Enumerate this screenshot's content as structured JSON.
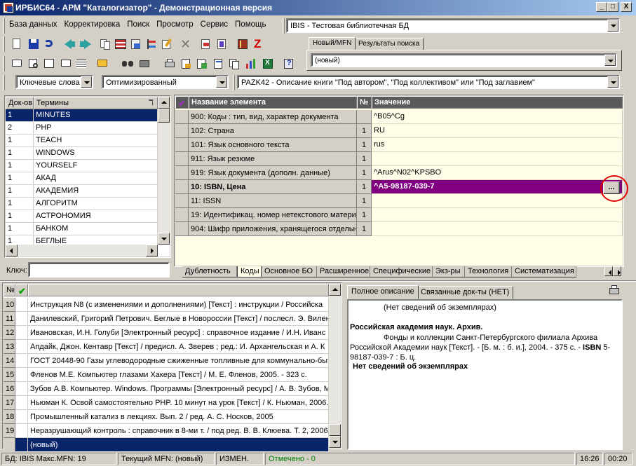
{
  "window": {
    "title": "ИРБИС64 - АРМ \"Каталогизатор\" - Демонстрационная версия",
    "controls": [
      "_",
      "□",
      "X"
    ]
  },
  "menu": [
    "База данных",
    "Корректировка",
    "Поиск",
    "Просмотр",
    "Сервис",
    "Помощь"
  ],
  "database_combo": "IBIS - Тестовая библиотечная БД",
  "top_tabs": [
    "Новый/MFN",
    "Результаты поиска"
  ],
  "mfn_combo": "(новый)",
  "search": {
    "mode": "Ключевые слова",
    "method": "Оптимизированный",
    "worksheet": "PAZK42 - Описание книги \"Под автором\", \"Под коллективом\" или \"Под заглавием\""
  },
  "terms": {
    "headers": [
      "Док-ов",
      "Термины"
    ],
    "rows": [
      {
        "count": "1",
        "term": "MINUTES"
      },
      {
        "count": "2",
        "term": "PHP"
      },
      {
        "count": "1",
        "term": "TEACH"
      },
      {
        "count": "1",
        "term": "WINDOWS"
      },
      {
        "count": "1",
        "term": "YOURSELF"
      },
      {
        "count": "1",
        "term": "АКАД"
      },
      {
        "count": "1",
        "term": "АКАДЕМИЯ"
      },
      {
        "count": "1",
        "term": "АЛГОРИТМ"
      },
      {
        "count": "1",
        "term": "АСТРОНОМИЯ"
      },
      {
        "count": "1",
        "term": "БАНКОМ"
      },
      {
        "count": "1",
        "term": "БЕГЛЫЕ"
      }
    ],
    "key_label": "Ключ:"
  },
  "record": {
    "headers": [
      "Название элемента",
      "№",
      "Значение"
    ],
    "rows": [
      {
        "name": "900: Коды : тип, вид, характер документа",
        "num": "",
        "value": "^B05^Cg"
      },
      {
        "name": "102: Страна",
        "num": "1",
        "value": "RU"
      },
      {
        "name": "101: Язык основного текста",
        "num": "1",
        "value": "rus"
      },
      {
        "name": "911: Язык резюме",
        "num": "1",
        "value": ""
      },
      {
        "name": "919: Язык документа (дополн. данные)",
        "num": "1",
        "value": "^Arus^N02^KPSBO"
      },
      {
        "name": "10: ISBN, Цена",
        "num": "1",
        "value": "^A5-98187-039-7"
      },
      {
        "name": "11: ISSN",
        "num": "1",
        "value": ""
      },
      {
        "name": "19: Идентификац. номер нетекстового матери",
        "num": "1",
        "value": ""
      },
      {
        "name": "904: Шифр приложения, хранящегося отдельно",
        "num": "1",
        "value": ""
      }
    ],
    "ellipsis_button": "..."
  },
  "record_tabs": [
    "Дублетность",
    "Коды",
    "Основное БО",
    "Расширенное",
    "Специфические",
    "Экз-ры",
    "Технология",
    "Систематизация"
  ],
  "documents": {
    "header_num": "№",
    "rows": [
      {
        "num": "10",
        "text": "Инструкция N8   (с изменениями и дополнениями) [Текст] : инструкции / Российска"
      },
      {
        "num": "11",
        "text": "Данилевский, Григорий Петрович. Беглые в Новороссии [Текст] / послесл. Э. Вилен"
      },
      {
        "num": "12",
        "text": "Ивановская, И.Н. Голуби [Электронный ресурс] : справочное издание / И.Н. Иванс"
      },
      {
        "num": "13",
        "text": "Апдайк, Джон. Кентавр [Текст] / предисл. А. Зверев ; ред.: И. Архангельская и А. К"
      },
      {
        "num": "14",
        "text": "ГОСТ 20448-90 Газы углеводородные сжиженные топливные для коммунально-быт"
      },
      {
        "num": "15",
        "text": "Фленов М.Е. Компьютер глазами Хакера [Текст] / М. Е. Фленов, 2005. - 323 с."
      },
      {
        "num": "16",
        "text": "Зубов А.В. Компьютер. Windows. Программы [Электронный ресурс] / А. В. Зубов, М"
      },
      {
        "num": "17",
        "text": "Ньюман К. Освой самостоятельно PHP. 10 минут на урок [Текст] / К. Ньюман, 2006."
      },
      {
        "num": "18",
        "text": "Промышленный катализ в лекциях. Вып. 2 / ред. А. С. Носков, 2005"
      },
      {
        "num": "19",
        "text": "Неразрушающий контроль : справочник в 8-ми т. / под ред. В. В. Клюева. Т. 2, 2006."
      }
    ],
    "new_row": "(новый)"
  },
  "desc_tabs": [
    "Полное описание",
    "Связанные док-ты (НЕТ)"
  ],
  "description": {
    "line1": "(Нет сведений об экземплярах)",
    "org": "Российская академия наук. Архив.",
    "body": "Фонды и коллекции Санкт-Петербургского филиала Архива Российской Академии наук [Текст]. - [Б. м. : б. и.], 2004. - 375 с. - ",
    "isbn_label": "ISBN",
    "isbn_value": " 5-98187-039-7 : Б. ц.",
    "footer": "Нет сведений об экземплярах"
  },
  "status": {
    "db": "БД: IBIS Макс.MFN: 19",
    "current": "Текущий MFN: (новый)",
    "changed": "ИЗМЕН.",
    "marked": "Отмечено - 0",
    "time": "16:26",
    "time2": "00:20"
  },
  "colors": {
    "titlebar": "#0a246a",
    "selection": "#0a246a",
    "record_highlight": "#800080",
    "marked_green": "#008000",
    "annotation_red": "#e00000"
  }
}
